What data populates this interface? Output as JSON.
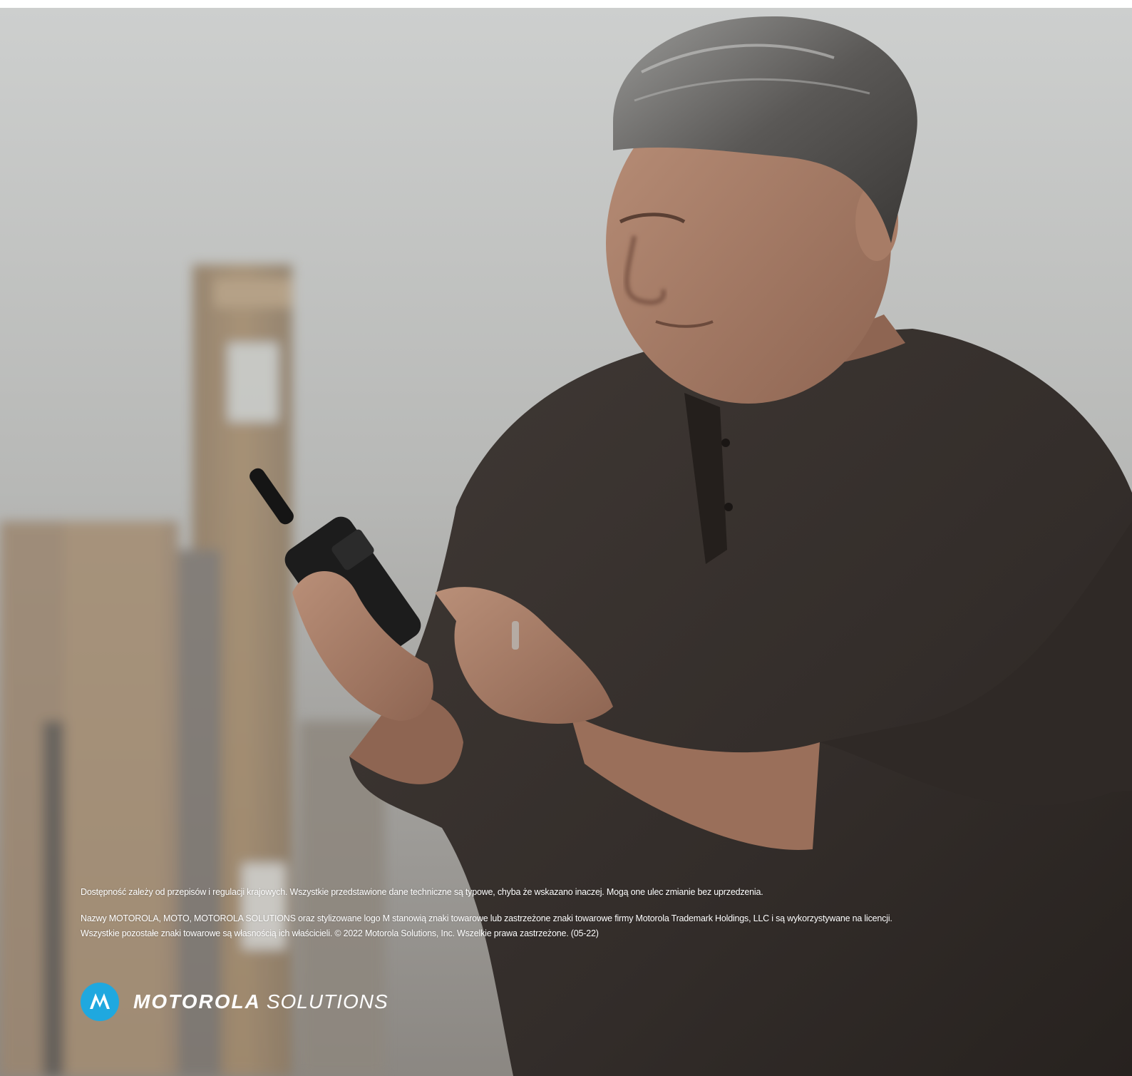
{
  "footer": {
    "disclaimer_line1": "Dostępność zależy od przepisów i regulacji krajowych. Wszystkie przedstawione dane techniczne są typowe, chyba że wskazano inaczej. Mogą one ulec zmianie bez uprzedzenia.",
    "trademark_line1": "Nazwy MOTOROLA, MOTO, MOTOROLA SOLUTIONS oraz stylizowane logo M stanowią znaki towarowe lub zastrzeżone znaki towarowe firmy Motorola Trademark Holdings, LLC i są wykorzystywane na licencji.",
    "trademark_line2": "Wszystkie pozostałe znaki towarowe są własnością ich właścicieli. © 2022 Motorola Solutions, Inc. Wszelkie prawa zastrzeżone. (05-22)"
  },
  "brand": {
    "word_bold": "MOTOROLA",
    "word_light": "SOLUTIONS",
    "accent_color": "#1fa8df",
    "icon": "motorola-batwing-m-icon"
  }
}
